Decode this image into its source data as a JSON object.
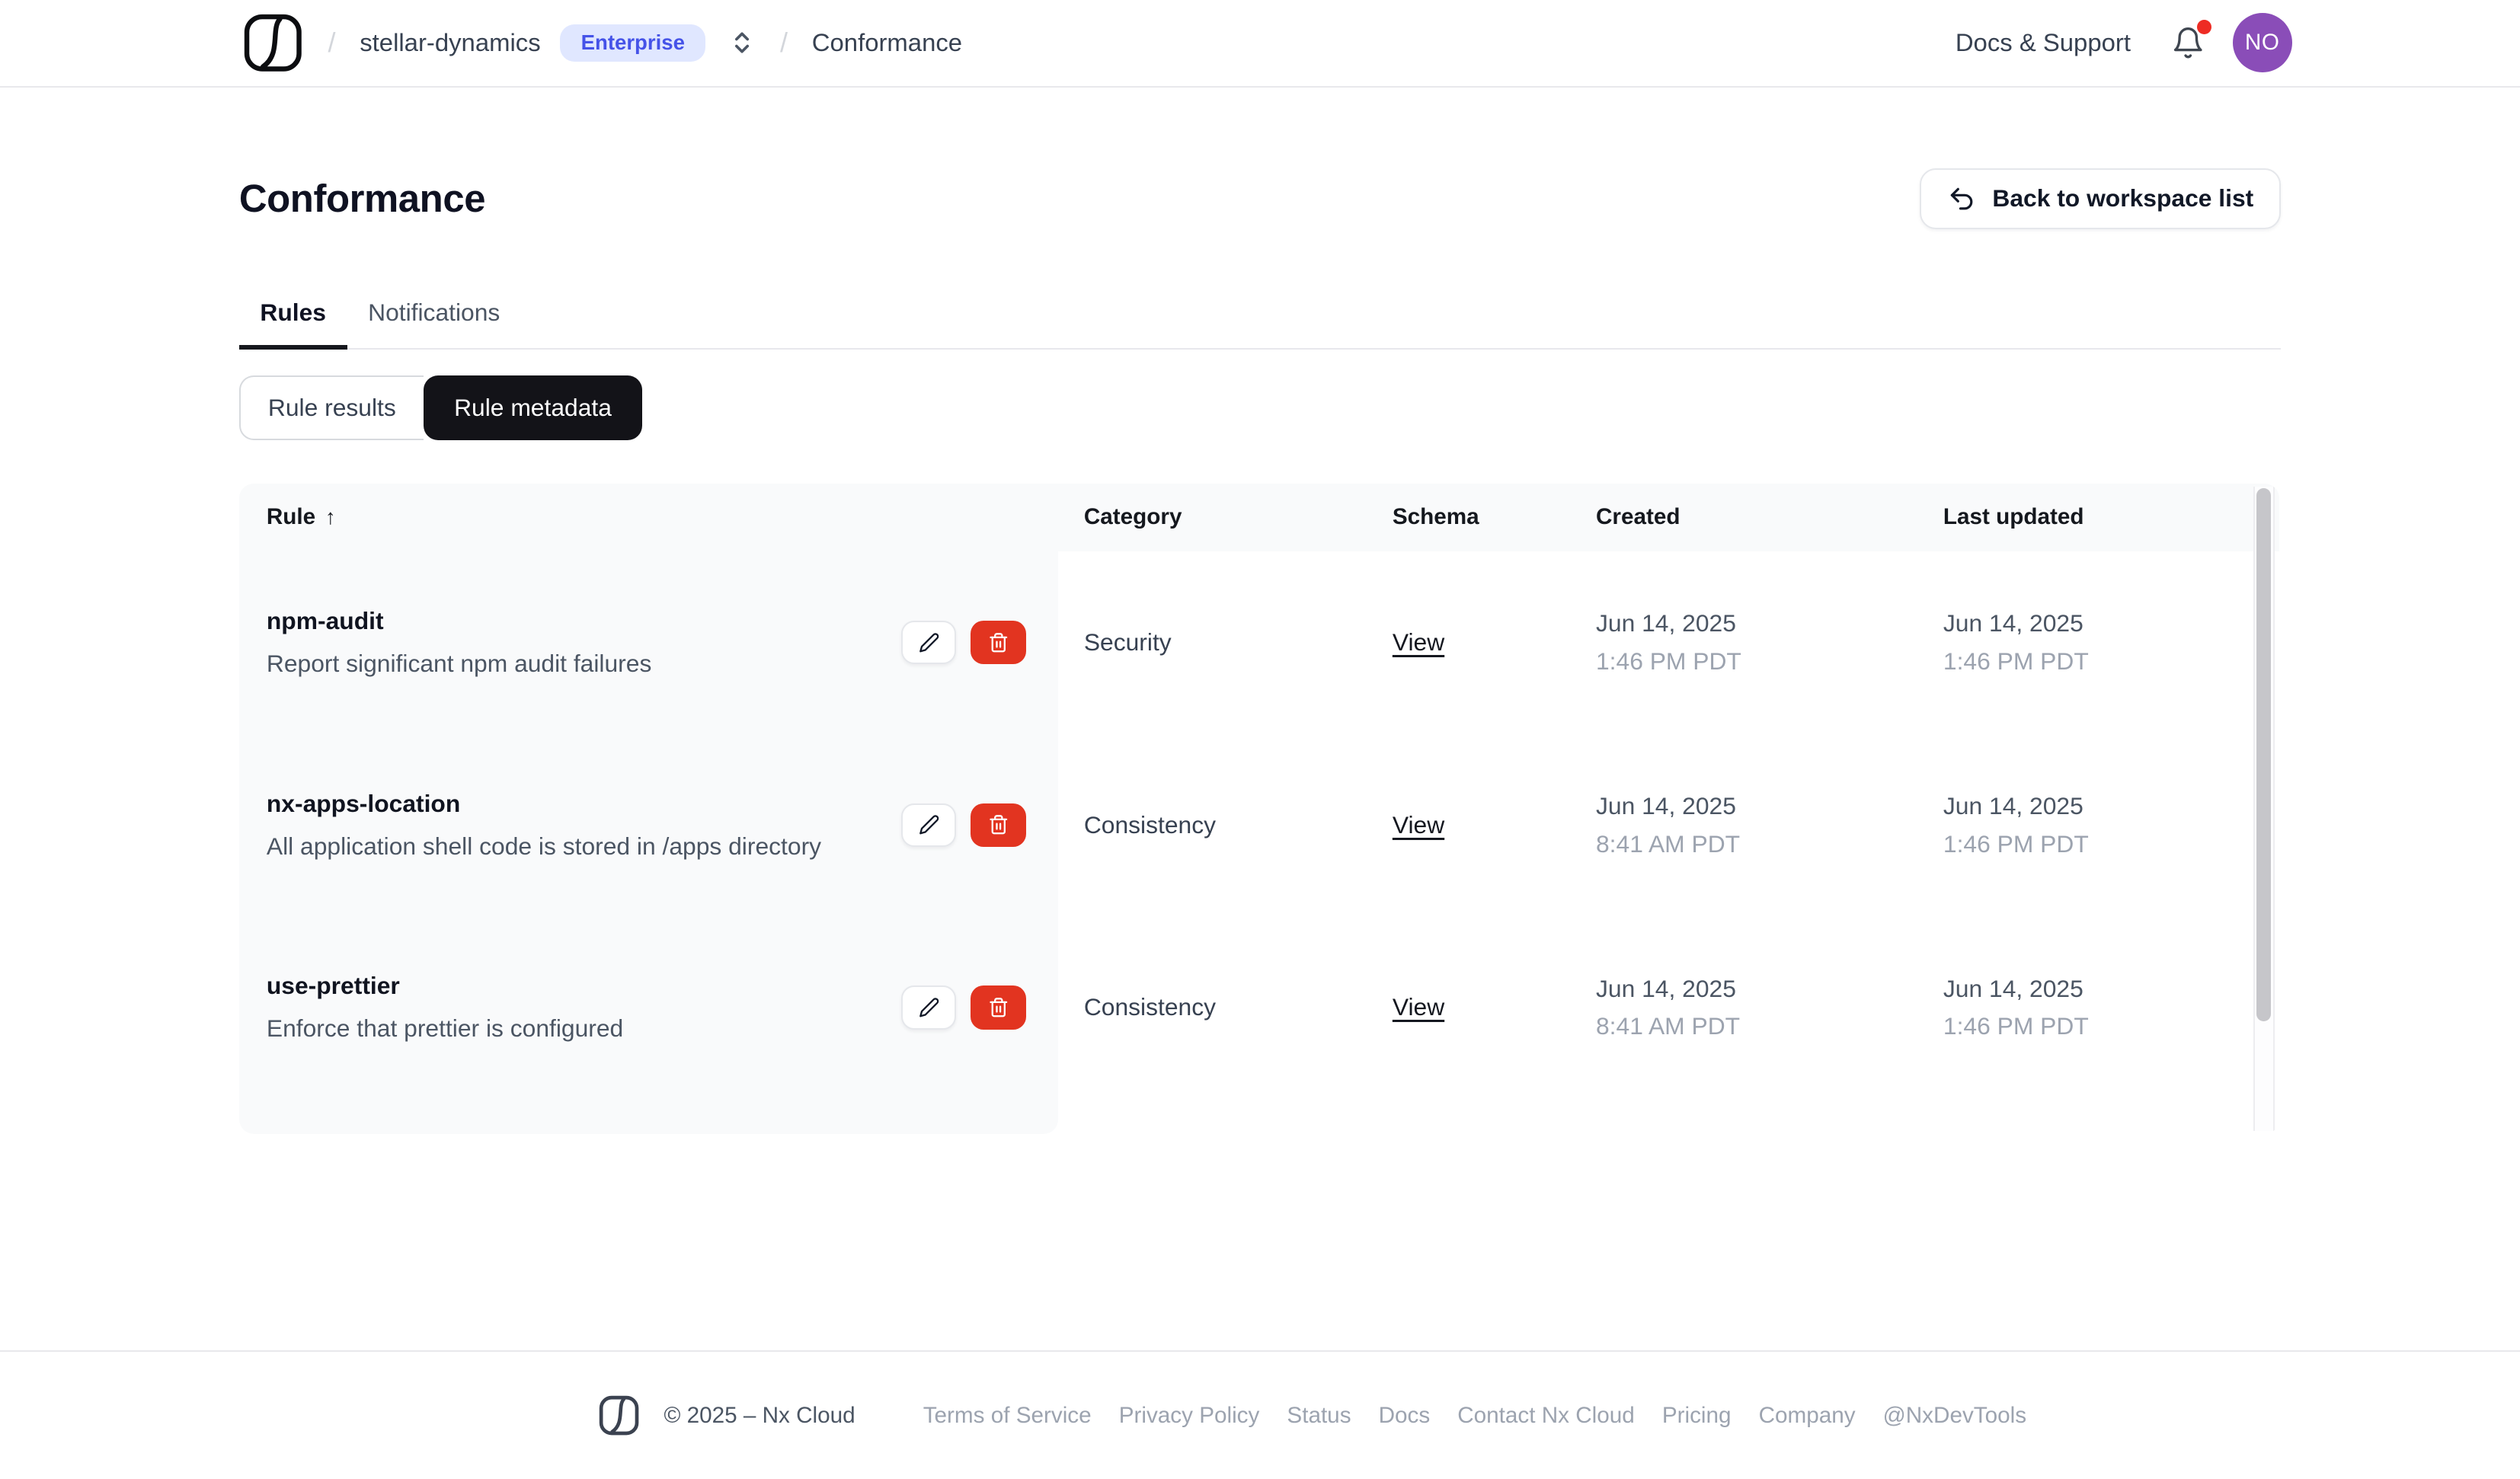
{
  "header": {
    "breadcrumb": {
      "separator": "/",
      "workspace": "stellar-dynamics",
      "plan_badge": "Enterprise",
      "page": "Conformance"
    },
    "docs_support": "Docs & Support",
    "avatar_initials": "NO"
  },
  "page": {
    "title": "Conformance",
    "back_button": "Back to workspace list"
  },
  "tabs": [
    {
      "label": "Rules",
      "active": true
    },
    {
      "label": "Notifications",
      "active": false
    }
  ],
  "segmented": [
    {
      "label": "Rule results",
      "active": false
    },
    {
      "label": "Rule metadata",
      "active": true
    }
  ],
  "table": {
    "columns": [
      "Rule",
      "Category",
      "Schema",
      "Created",
      "Last updated"
    ],
    "sort_indicator": "↑",
    "rows": [
      {
        "name": "npm-audit",
        "description": "Report significant npm audit failures",
        "category": "Security",
        "schema": "View",
        "created_date": "Jun 14, 2025",
        "created_time": "1:46 PM PDT",
        "updated_date": "Jun 14, 2025",
        "updated_time": "1:46 PM PDT"
      },
      {
        "name": "nx-apps-location",
        "description": "All application shell code is stored in /apps directory",
        "category": "Consistency",
        "schema": "View",
        "created_date": "Jun 14, 2025",
        "created_time": "8:41 AM PDT",
        "updated_date": "Jun 14, 2025",
        "updated_time": "1:46 PM PDT"
      },
      {
        "name": "use-prettier",
        "description": "Enforce that prettier is configured",
        "category": "Consistency",
        "schema": "View",
        "created_date": "Jun 14, 2025",
        "created_time": "8:41 AM PDT",
        "updated_date": "Jun 14, 2025",
        "updated_time": "1:46 PM PDT"
      }
    ]
  },
  "footer": {
    "copyright": "© 2025 – Nx Cloud",
    "links": [
      "Terms of Service",
      "Privacy Policy",
      "Status",
      "Docs",
      "Contact Nx Cloud",
      "Pricing",
      "Company",
      "@NxDevTools"
    ]
  },
  "icons": {
    "nx-cloud-logo": "rounded square with wave stroke",
    "bell-icon": "notification bell outline",
    "notification-dot": "red dot",
    "workspace-switcher-icon": "up/down chevrons",
    "undo-arrow-icon": "curved back arrow",
    "pencil-icon": "edit pencil",
    "trash-icon": "delete trash can",
    "sort-ascending-icon": "↑"
  },
  "colors": {
    "badge_bg": "#e0e7ff",
    "badge_text": "#4553e8",
    "avatar_bg": "#8a4db8",
    "notification_dot": "#ee2c24",
    "delete_button": "#e23420",
    "active_segment_bg": "#131318",
    "table_header_bg": "#f9fafb",
    "border": "#e8e8ec"
  }
}
